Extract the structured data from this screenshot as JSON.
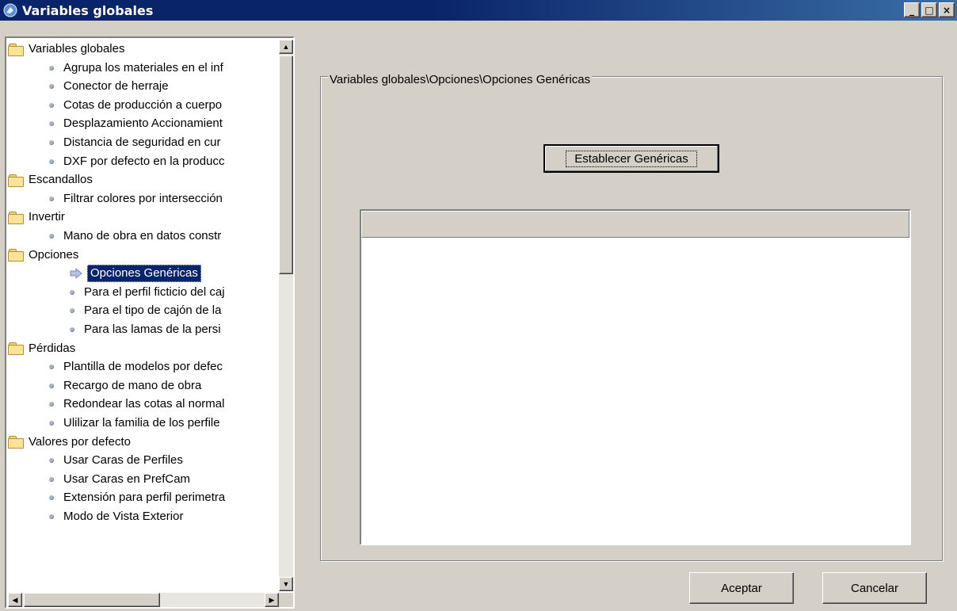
{
  "window": {
    "title": "Variables globales",
    "controls": [
      "_",
      "□",
      "×"
    ]
  },
  "tree": {
    "items": [
      {
        "label": "Variables globales",
        "type": "folder",
        "level": 0
      },
      {
        "label": "Agrupa los materiales en el inf",
        "type": "leaf",
        "level": 1
      },
      {
        "label": "Conector de herraje",
        "type": "leaf",
        "level": 1
      },
      {
        "label": "Cotas de producción a cuerpo",
        "type": "leaf",
        "level": 1
      },
      {
        "label": "Desplazamiento Accionamient",
        "type": "leaf",
        "level": 1
      },
      {
        "label": "Distancia de seguridad en cur",
        "type": "leaf",
        "level": 1
      },
      {
        "label": "DXF por defecto en la producc",
        "type": "leaf",
        "level": 1
      },
      {
        "label": "Escandallos",
        "type": "folder",
        "level": 1
      },
      {
        "label": "Filtrar colores por intersección",
        "type": "leaf",
        "level": 1
      },
      {
        "label": "Invertir",
        "type": "folder",
        "level": 1
      },
      {
        "label": "Mano de obra en datos constr",
        "type": "leaf",
        "level": 1
      },
      {
        "label": "Opciones",
        "type": "folder",
        "level": 1
      },
      {
        "label": "Opciones Genéricas",
        "type": "selected",
        "level": 2
      },
      {
        "label": "Para el perfil ficticio del caj",
        "type": "leaf",
        "level": 2
      },
      {
        "label": "Para el tipo de cajón de la",
        "type": "leaf",
        "level": 2
      },
      {
        "label": "Para las lamas de la persi",
        "type": "leaf",
        "level": 2
      },
      {
        "label": "Pérdidas",
        "type": "folder",
        "level": 1
      },
      {
        "label": "Plantilla de modelos por defec",
        "type": "leaf",
        "level": 1
      },
      {
        "label": "Recargo de mano de obra",
        "type": "leaf",
        "level": 1
      },
      {
        "label": "Redondear las cotas al normal",
        "type": "leaf",
        "level": 1
      },
      {
        "label": "Ulilizar la familia de los perfile",
        "type": "leaf",
        "level": 1
      },
      {
        "label": "Valores por defecto",
        "type": "folder",
        "level": 1
      },
      {
        "label": "Usar Caras de Perfiles",
        "type": "leaf",
        "level": 1
      },
      {
        "label": "Usar Caras en PrefCam",
        "type": "leaf",
        "level": 1
      },
      {
        "label": "Extensión para perfil perimetra",
        "type": "leaf",
        "level": 1
      },
      {
        "label": "Modo de Vista Exterior",
        "type": "leaf",
        "level": 1
      }
    ]
  },
  "panel": {
    "group_title": "Variables globales\\Opciones\\Opciones Genéricas",
    "set_generic_label": "Establecer Genéricas"
  },
  "footer": {
    "accept_label": "Aceptar",
    "cancel_label": "Cancelar"
  }
}
